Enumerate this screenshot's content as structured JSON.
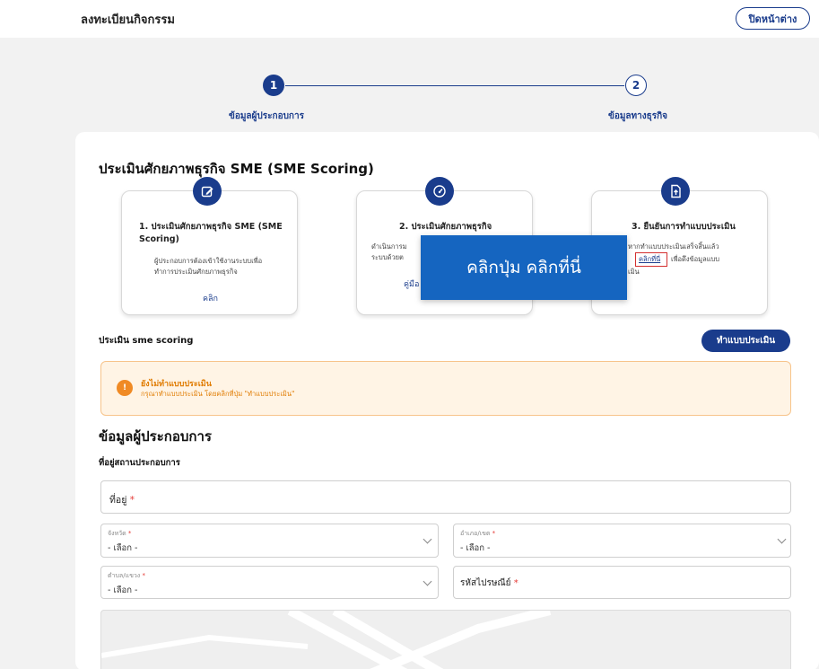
{
  "header": {
    "title": "ลงทะเบียนกิจกรรม",
    "close_label": "ปิดหน้าต่าง"
  },
  "stepper": {
    "steps": [
      {
        "number": "1",
        "label": "ข้อมูลผู้ประกอบการ",
        "active": true
      },
      {
        "number": "2",
        "label": "ข้อมูลทางธุรกิจ",
        "active": false
      }
    ]
  },
  "sme": {
    "title": "ประเมินศักยภาพธุรกิจ SME (SME Scoring)",
    "tiles": [
      {
        "icon": "edit-icon",
        "title_line1": "1. ประเมินศักยภาพธุรกิจ SME (SME",
        "title_line2": "Scoring)",
        "desc_line1": "ผู้ประกอบการต้องเข้าใช้งานระบบเพื่อ",
        "desc_line2": "ทำการประเมินศักยภาพธุรกิจ",
        "link": "คลิก"
      },
      {
        "icon": "gauge-icon",
        "title": "2. ประเมินศักยภาพธุรกิจ",
        "desc_line1": "ดำเนินการม",
        "desc_line2": "ระบบด้วยต",
        "link": "คู่มือ"
      },
      {
        "icon": "upload-file-icon",
        "title": "3. ยืนยันการทำแบบประเมิน",
        "desc_line1": "หากทำแบบประเมินเสร็จสิ้นแล้ว",
        "desc_line2_pre": "",
        "desc_line2_link": "คลิกที่นี่",
        "desc_line2_post": "เพื่อดึงข้อมูลแบบ",
        "desc_line3": "เมิน"
      }
    ],
    "tooltip": "คลิกปุ่ม คลิกที่นี่"
  },
  "evaluation": {
    "label": "ประเมิน sme scoring",
    "button": "ทำแบบประเมิน",
    "alert_title": "ยังไม่ทำแบบประเมิน",
    "alert_sub": "กรุณาทำแบบประเมิน โดยคลิกที่ปุ่ม \"ทำแบบประเมิน\""
  },
  "operator": {
    "title": "ข้อมูลผู้ประกอบการ",
    "address_section": "ที่อยู่สถานประกอบการ",
    "address_placeholder": "ที่อยู่",
    "province_label": "จังหวัด",
    "province_value": "- เลือก -",
    "district_label": "อำเภอ/เขต",
    "district_value": "- เลือก -",
    "subdistrict_label": "ตำบล/แขวง",
    "subdistrict_value": "- เลือก -",
    "postcode_placeholder": "รหัสไปรษณีย์",
    "required_mark": "*"
  },
  "colors": {
    "primary": "#1a3c8c",
    "tooltip": "#1565c0",
    "warning": "#f08a24",
    "highlight": "#d32f2f"
  }
}
